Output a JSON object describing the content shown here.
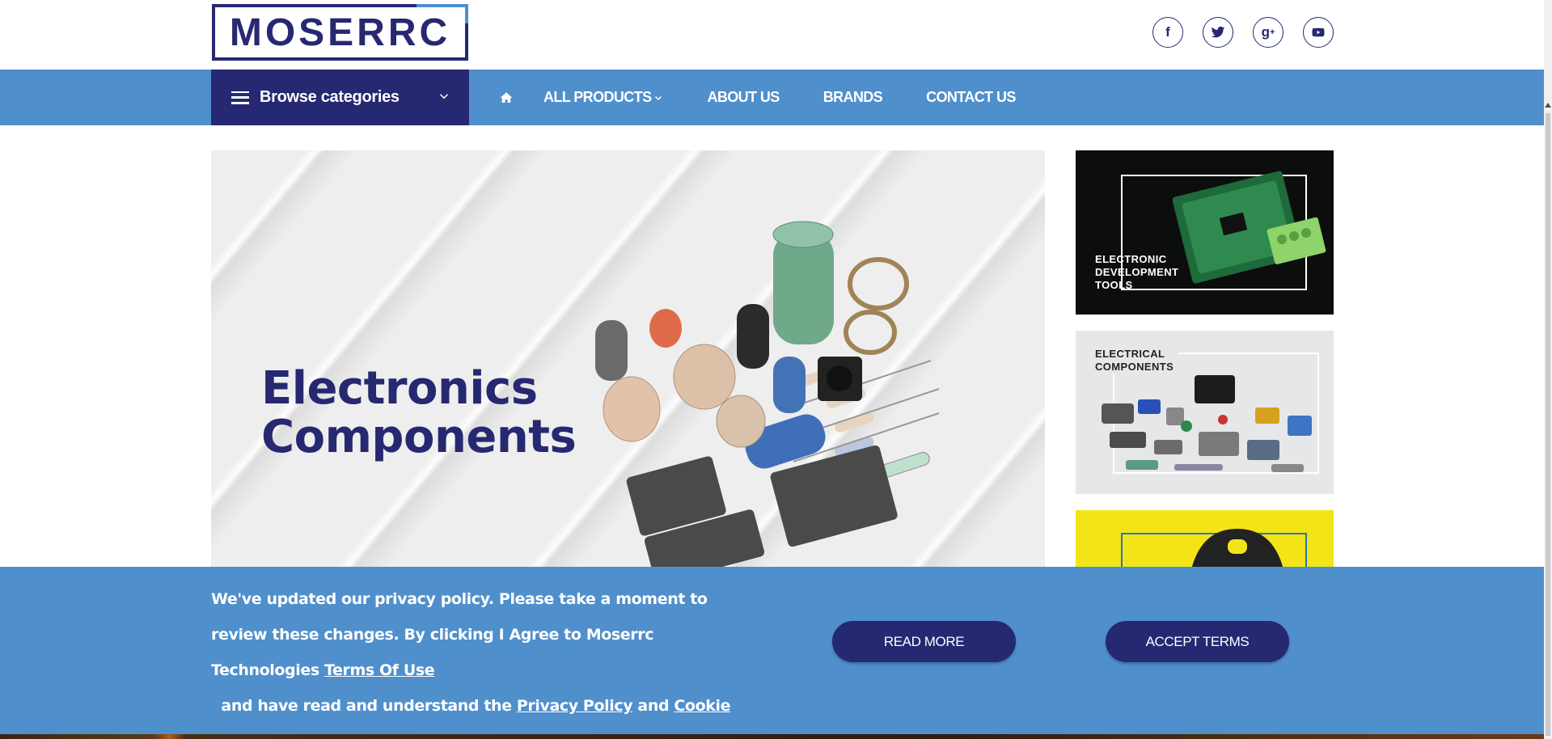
{
  "header": {
    "logo_text": "MOSERRC",
    "social": [
      {
        "icon": "facebook-icon",
        "glyph": "f"
      },
      {
        "icon": "twitter-icon",
        "glyph": ""
      },
      {
        "icon": "google-plus-icon",
        "glyph": "g+"
      },
      {
        "icon": "youtube-icon",
        "glyph": ""
      }
    ]
  },
  "nav": {
    "browse_label": "Browse categories",
    "links": [
      "ALL PRODUCTS",
      "ABOUT US",
      "BRANDS",
      "CONTACT US"
    ]
  },
  "hero": {
    "title_line1": "Electronics",
    "title_line2": "Components"
  },
  "tiles": [
    {
      "label_lines": [
        "ELECTRONIC",
        "DEVELOPMENT",
        "TOOLS"
      ]
    },
    {
      "label_lines": [
        "ELECTRICAL",
        "COMPONENTS"
      ]
    },
    {
      "label_lines": []
    }
  ],
  "cookie": {
    "text_part1": "We've updated our privacy policy. Please take a moment to review these changes. By clicking I Agree to Moserrc Technologies ",
    "terms_link": "Terms Of Use",
    "text_part2": "  and have read and understand the ",
    "privacy_link": "Privacy Policy",
    "text_part3": " and ",
    "cookie_link": "Cookie Policy.",
    "read_more": "READ MORE",
    "accept_terms": "ACCEPT TERMS"
  },
  "colors": {
    "brand_navy": "#262871",
    "brand_blue": "#4f8fcc",
    "tile_yellow": "#f3e418"
  }
}
